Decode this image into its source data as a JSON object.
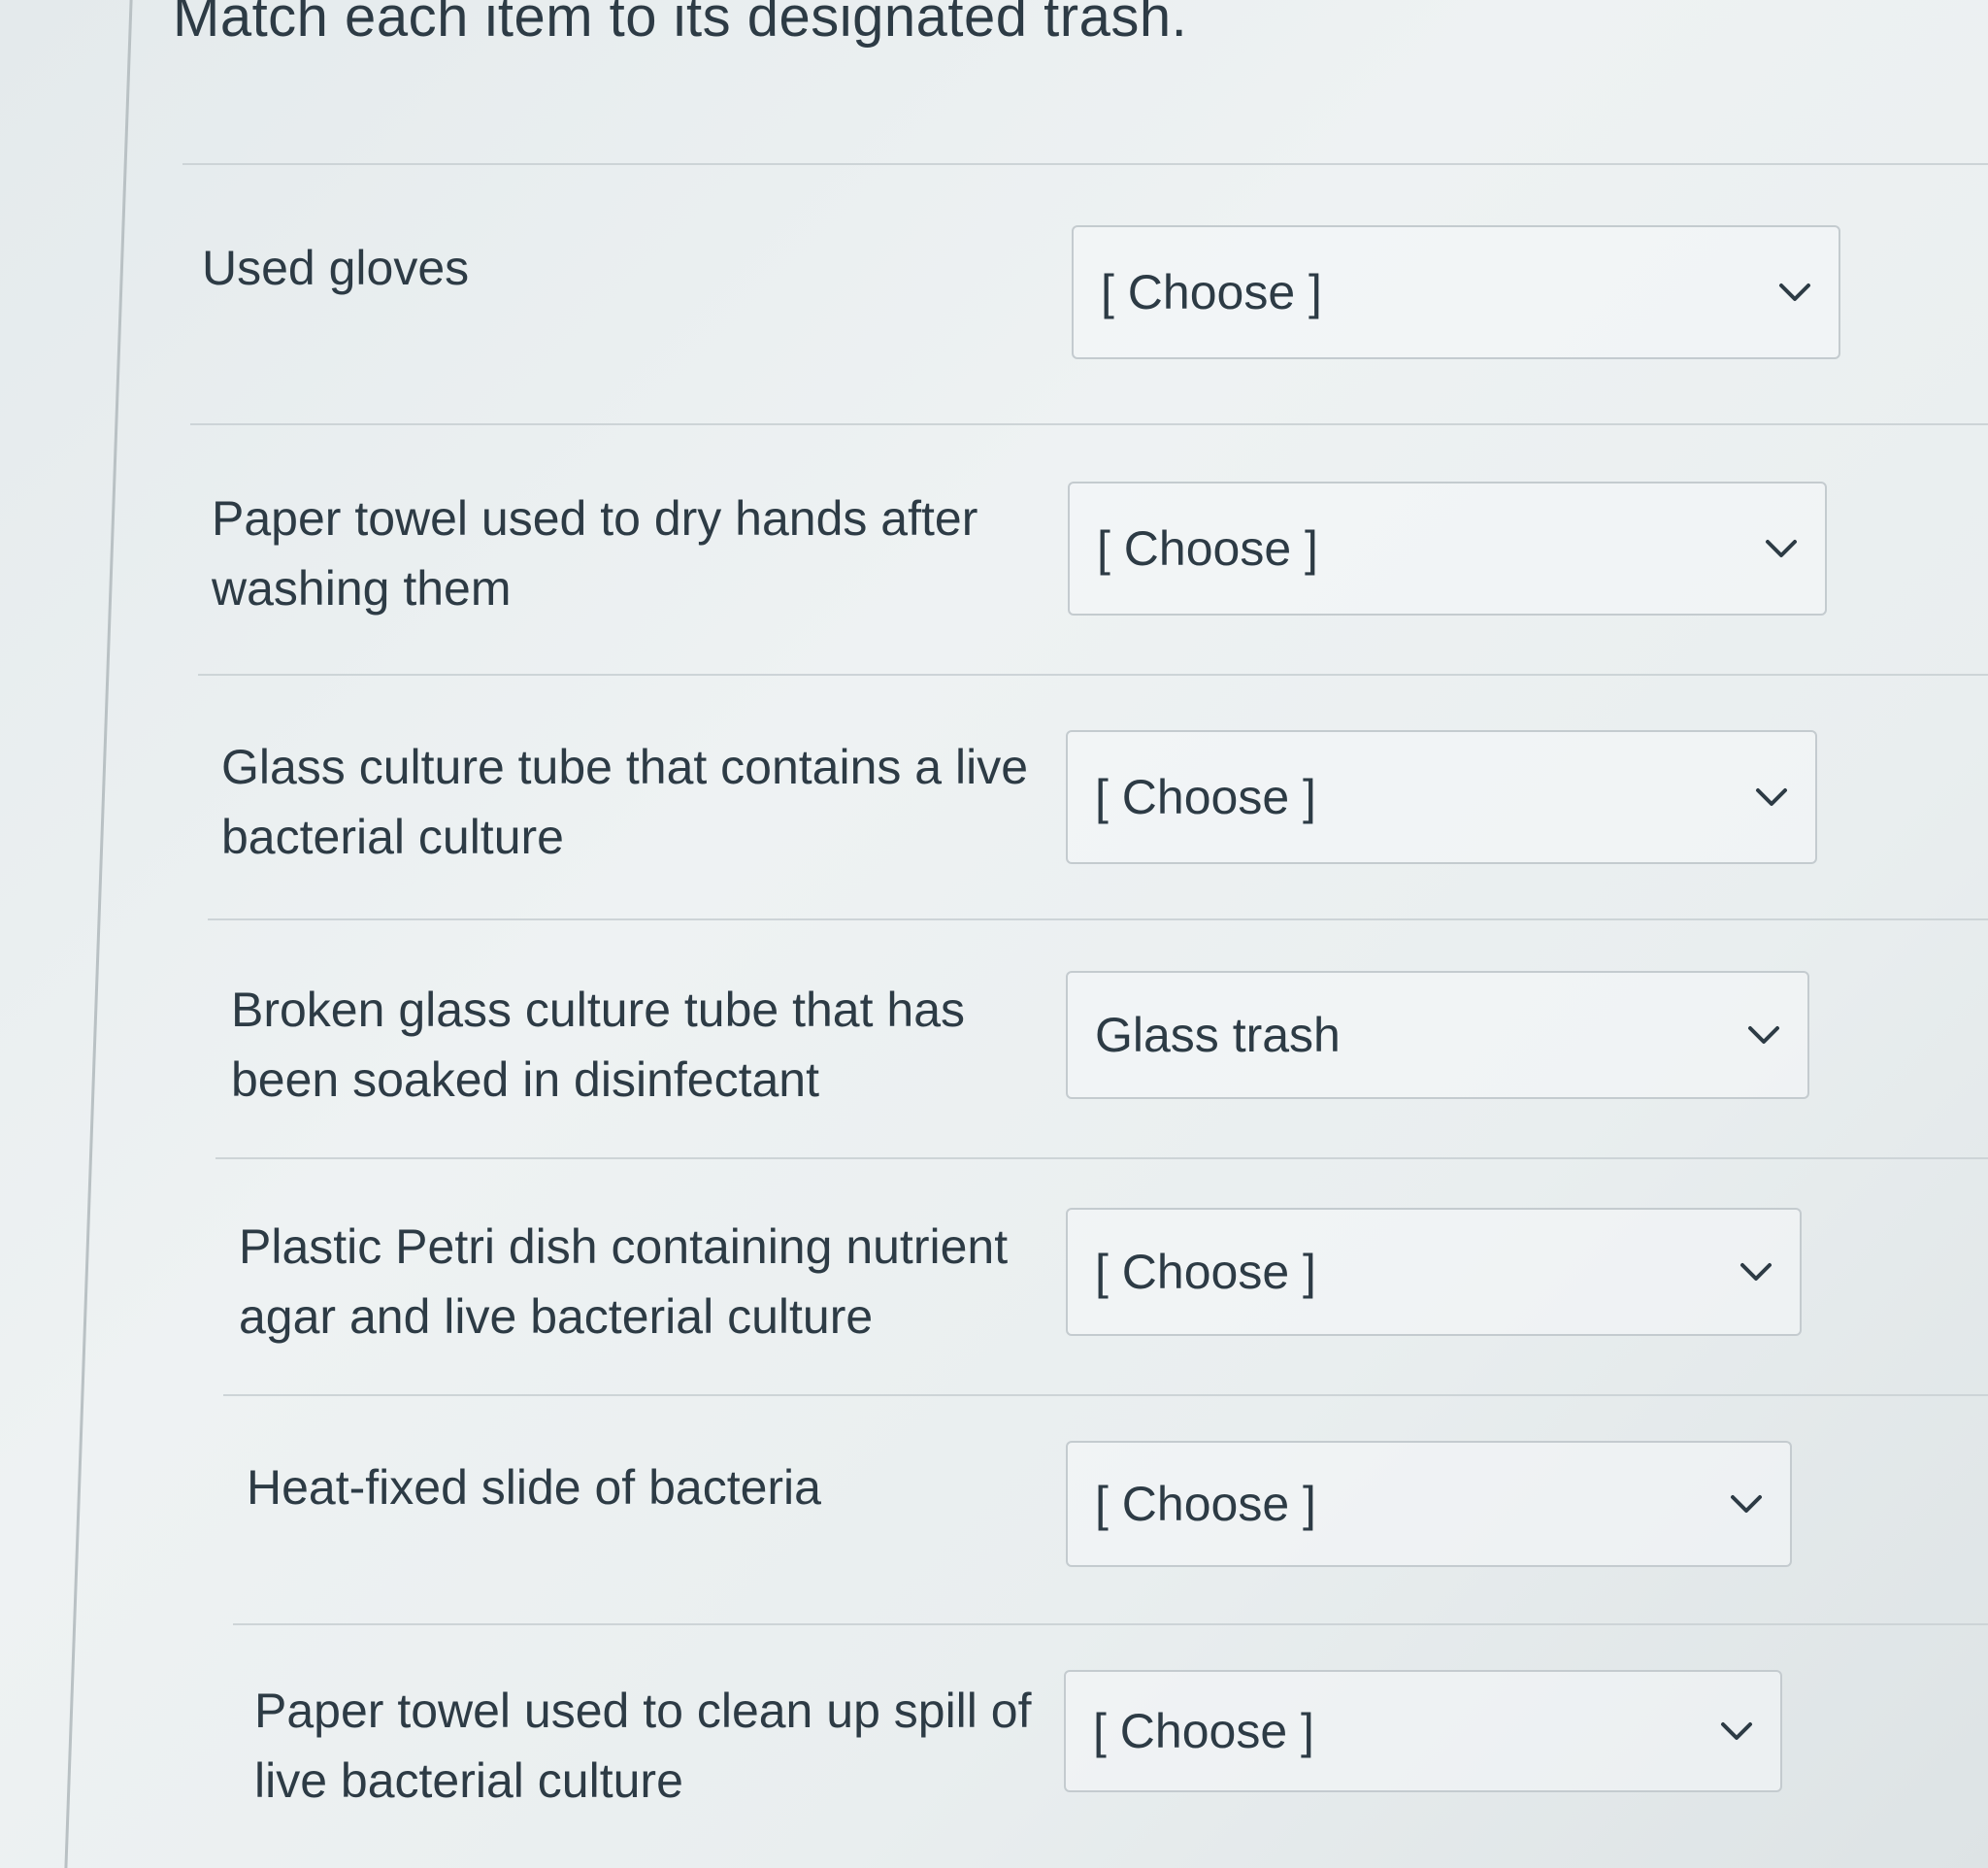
{
  "question": {
    "title": "Match each item to its designated trash."
  },
  "items": [
    {
      "label": "Used gloves",
      "selected": "[ Choose ]"
    },
    {
      "label": "Paper towel used to dry hands after washing them",
      "selected": "[ Choose ]"
    },
    {
      "label": "Glass culture tube that contains a live bacterial culture",
      "selected": "[ Choose ]"
    },
    {
      "label": "Broken glass culture tube that has been soaked in disinfectant",
      "selected": "Glass trash"
    },
    {
      "label": "Plastic Petri dish containing nutrient agar and live bacterial culture",
      "selected": "[ Choose ]"
    },
    {
      "label": "Heat-fixed slide of bacteria",
      "selected": "[ Choose ]"
    },
    {
      "label": "Paper towel used to clean up spill of live bacterial culture",
      "selected": "[ Choose ]"
    }
  ],
  "icons": {
    "dropdown": "chevron-down-icon"
  },
  "colors": {
    "text": "#2d3b45",
    "border": "#c4cbcf",
    "divider": "#cdd4d7"
  }
}
